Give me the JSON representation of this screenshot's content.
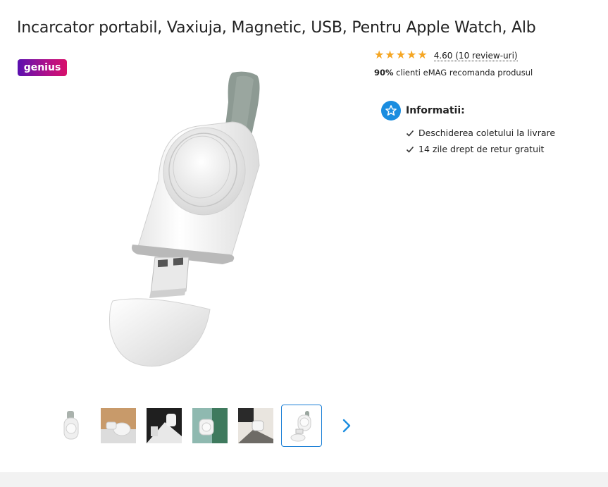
{
  "product": {
    "title": "Incarcator portabil, Vaxiuja, Magnetic, USB, Pentru Apple Watch, Alb",
    "badge": "genius"
  },
  "rating": {
    "stars": 5,
    "value_text": "4.60 (10 review-uri)",
    "recommend_percent": "90%",
    "recommend_text": " clienti eMAG recomanda produsul"
  },
  "info": {
    "title": "Informatii:",
    "items": [
      "Deschiderea coletului la livrare",
      "14 zile drept de retur gratuit"
    ]
  },
  "gallery": {
    "thumbnails": [
      {
        "icon": "charger-front-thumb"
      },
      {
        "icon": "charger-wood-thumb"
      },
      {
        "icon": "charger-dark-thumb"
      },
      {
        "icon": "charger-green-thumb"
      },
      {
        "icon": "charger-desk-thumb"
      },
      {
        "icon": "charger-white-thumb",
        "selected": true
      }
    ],
    "next_icon": "chevron-right-icon"
  },
  "colors": {
    "accent": "#1a8de0",
    "star": "#f5a623",
    "genius_start": "#5a0fb0",
    "genius_end": "#d8106a",
    "active_border": "#1a7fd6"
  }
}
